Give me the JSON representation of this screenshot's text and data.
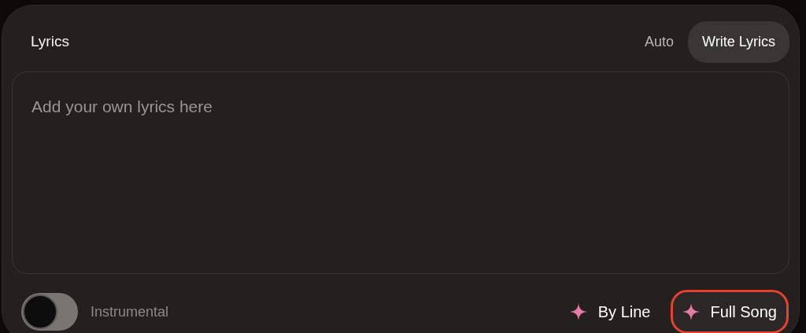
{
  "title": "Lyrics",
  "modes": [
    {
      "label": "Auto",
      "selected": false
    },
    {
      "label": "Write Lyrics",
      "selected": true
    }
  ],
  "lyrics": {
    "placeholder": "Add your own lyrics here"
  },
  "instrumental": {
    "label": "Instrumental",
    "on": false
  },
  "actions": [
    {
      "label": "By Line",
      "highlighted": false
    },
    {
      "label": "Full Song",
      "highlighted": true
    }
  ]
}
